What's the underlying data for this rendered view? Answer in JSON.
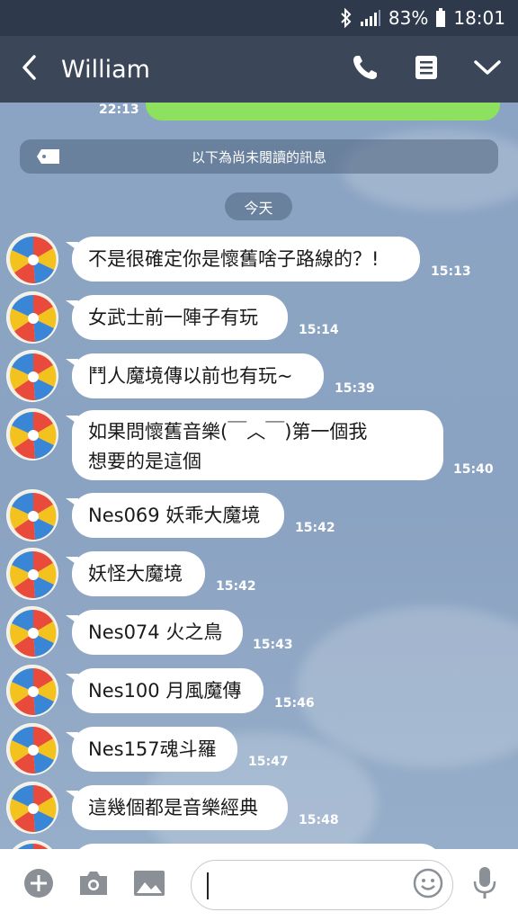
{
  "status_bar": {
    "battery": "83%",
    "time": "18:01"
  },
  "header": {
    "title": "William"
  },
  "chat": {
    "prev_time": "22:13",
    "unread_banner": "以下為尚未閱讀的訊息",
    "day_label": "今天",
    "messages": [
      {
        "text": "不是很確定你是懷舊啥子路線的？!",
        "time": "15:13"
      },
      {
        "text": "女武士前一陣子有玩",
        "time": "15:14"
      },
      {
        "text": "鬥人魔境傳以前也有玩~",
        "time": "15:39"
      },
      {
        "text_line1": "如果問懷舊音樂(￣︿￣)第一個我",
        "text_line2": "想要的是這個",
        "time": "15:40"
      },
      {
        "text": "Nes069 妖乖大魔境",
        "time": "15:42"
      },
      {
        "text": "妖怪大魔境",
        "time": "15:42"
      },
      {
        "text": "Nes074 火之鳥",
        "time": "15:43"
      },
      {
        "text": "Nes100 月風魔傳",
        "time": "15:46"
      },
      {
        "text": "Nes157魂斗羅",
        "time": "15:47"
      },
      {
        "text": "這幾個都是音樂經典",
        "time": "15:48"
      }
    ]
  },
  "icons": {
    "back": "chevron-left-icon",
    "call": "phone-icon",
    "menu": "note-icon",
    "more": "chevron-down-icon",
    "add": "plus-circle-icon",
    "camera": "camera-icon",
    "image": "image-icon",
    "emoji": "smiley-icon",
    "mic": "microphone-icon"
  },
  "colors": {
    "header": "#3b4759",
    "status": "#2e3a4c",
    "bubble": "#ffffff",
    "sent_bubble": "#8de15f",
    "chat_bg": "#8aa3c2"
  }
}
